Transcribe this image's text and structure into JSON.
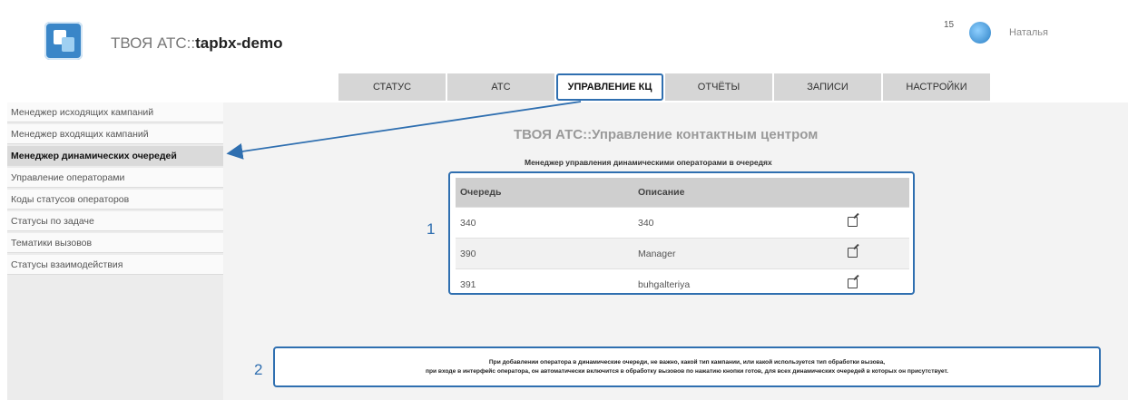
{
  "header": {
    "app_title_prefix": "ТВОЯ АТС::",
    "app_title_bold": "tapbx-demo",
    "notification_count": "15",
    "user_name": "Наталья"
  },
  "topnav": {
    "tabs": [
      {
        "label": "Статус"
      },
      {
        "label": "АТС"
      },
      {
        "label": "Управление КЦ"
      },
      {
        "label": "Отчёты"
      },
      {
        "label": "Записи"
      },
      {
        "label": "Настройки"
      }
    ],
    "active_index": 2
  },
  "sidebar": {
    "items": [
      {
        "label": "Менеджер исходящих кампаний"
      },
      {
        "label": "Менеджер входящих кампаний"
      },
      {
        "label": "Менеджер динамических очередей"
      },
      {
        "label": "Управление операторами"
      },
      {
        "label": "Коды статусов операторов"
      },
      {
        "label": "Статусы по задаче"
      },
      {
        "label": "Тематики вызовов"
      },
      {
        "label": "Статусы взаимодействия"
      }
    ],
    "active_index": 2
  },
  "main": {
    "title": "ТВОЯ АТС::Управление контактным центром",
    "subtitle": "Менеджер управления динамическими операторами в очередях",
    "table": {
      "columns": [
        "Очередь",
        "Описание"
      ],
      "rows": [
        {
          "queue": "340",
          "description": "340"
        },
        {
          "queue": "390",
          "description": "Manager"
        },
        {
          "queue": "391",
          "description": "buhgalteriya"
        }
      ]
    },
    "callout_1": "1",
    "callout_2": "2",
    "note_line1": "При добавлении оператора в динамические очереди, не важно, какой тип кампании, или какой используется тип обработки вызова,",
    "note_line2": "при входе в интерфейс оператора, он автоматически включится в обработку вызовов по нажатию кнопки готов, для всех динамических очередей в которых он присутствует."
  },
  "colors": {
    "accent": "#2f6fb0",
    "tab_bg": "#d6d6d6",
    "content_bg": "#f3f3f3"
  }
}
